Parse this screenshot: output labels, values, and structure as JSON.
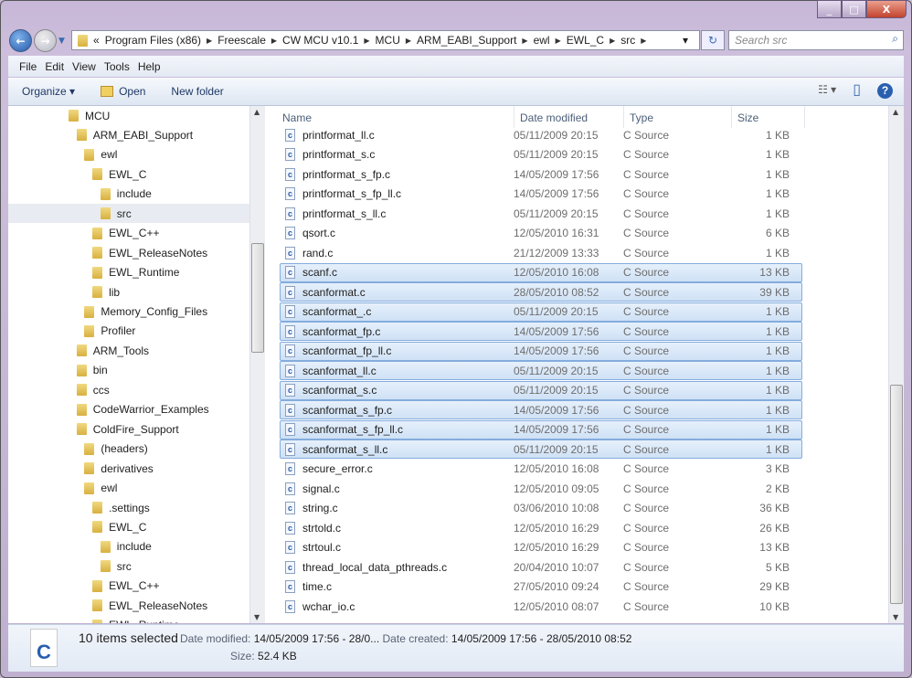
{
  "window": {
    "minimize": "_",
    "maximize": "□",
    "close": "X"
  },
  "address": {
    "prefix": "«",
    "crumbs": [
      "Program Files (x86)",
      "Freescale",
      "CW MCU v10.1",
      "MCU",
      "ARM_EABI_Support",
      "ewl",
      "EWL_C",
      "src"
    ],
    "dropdown": "▾",
    "refresh": "↻"
  },
  "search": {
    "placeholder": "Search src",
    "icon": "magnifier-icon"
  },
  "menu": [
    "File",
    "Edit",
    "View",
    "Tools",
    "Help"
  ],
  "toolbar": {
    "organize": "Organize ▾",
    "open": "Open",
    "new_folder": "New folder",
    "views": "☷ ▾",
    "preview": "▯",
    "help": "?"
  },
  "tree": [
    {
      "label": "MCU",
      "level": 0
    },
    {
      "label": "ARM_EABI_Support",
      "level": 1
    },
    {
      "label": "ewl",
      "level": 2
    },
    {
      "label": "EWL_C",
      "level": 3
    },
    {
      "label": "include",
      "level": 4
    },
    {
      "label": "src",
      "level": 4,
      "selected": true
    },
    {
      "label": "EWL_C++",
      "level": 3
    },
    {
      "label": "EWL_ReleaseNotes",
      "level": 3
    },
    {
      "label": "EWL_Runtime",
      "level": 3
    },
    {
      "label": "lib",
      "level": 3
    },
    {
      "label": "Memory_Config_Files",
      "level": 2
    },
    {
      "label": "Profiler",
      "level": 2
    },
    {
      "label": "ARM_Tools",
      "level": 1
    },
    {
      "label": "bin",
      "level": 1
    },
    {
      "label": "ccs",
      "level": 1
    },
    {
      "label": "CodeWarrior_Examples",
      "level": 1
    },
    {
      "label": "ColdFire_Support",
      "level": 1
    },
    {
      "label": "(headers)",
      "level": 2
    },
    {
      "label": "derivatives",
      "level": 2
    },
    {
      "label": "ewl",
      "level": 2
    },
    {
      "label": ".settings",
      "level": 3
    },
    {
      "label": "EWL_C",
      "level": 3
    },
    {
      "label": "include",
      "level": 4
    },
    {
      "label": "src",
      "level": 4
    },
    {
      "label": "EWL_C++",
      "level": 3
    },
    {
      "label": "EWL_ReleaseNotes",
      "level": 3
    },
    {
      "label": "EWL_Runtime",
      "level": 3
    }
  ],
  "columns": [
    "Name",
    "Date modified",
    "Type",
    "Size"
  ],
  "files": [
    [
      "printformat_ll.c",
      "05/11/2009 20:15",
      "C Source",
      "1 KB",
      0
    ],
    [
      "printformat_s.c",
      "05/11/2009 20:15",
      "C Source",
      "1 KB",
      0
    ],
    [
      "printformat_s_fp.c",
      "14/05/2009 17:56",
      "C Source",
      "1 KB",
      0
    ],
    [
      "printformat_s_fp_ll.c",
      "14/05/2009 17:56",
      "C Source",
      "1 KB",
      0
    ],
    [
      "printformat_s_ll.c",
      "05/11/2009 20:15",
      "C Source",
      "1 KB",
      0
    ],
    [
      "qsort.c",
      "12/05/2010 16:31",
      "C Source",
      "6 KB",
      0
    ],
    [
      "rand.c",
      "21/12/2009 13:33",
      "C Source",
      "1 KB",
      0
    ],
    [
      "scanf.c",
      "12/05/2010 16:08",
      "C Source",
      "13 KB",
      1
    ],
    [
      "scanformat.c",
      "28/05/2010 08:52",
      "C Source",
      "39 KB",
      1
    ],
    [
      "scanformat_.c",
      "05/11/2009 20:15",
      "C Source",
      "1 KB",
      1
    ],
    [
      "scanformat_fp.c",
      "14/05/2009 17:56",
      "C Source",
      "1 KB",
      1
    ],
    [
      "scanformat_fp_ll.c",
      "14/05/2009 17:56",
      "C Source",
      "1 KB",
      1
    ],
    [
      "scanformat_ll.c",
      "05/11/2009 20:15",
      "C Source",
      "1 KB",
      1
    ],
    [
      "scanformat_s.c",
      "05/11/2009 20:15",
      "C Source",
      "1 KB",
      1
    ],
    [
      "scanformat_s_fp.c",
      "14/05/2009 17:56",
      "C Source",
      "1 KB",
      1
    ],
    [
      "scanformat_s_fp_ll.c",
      "14/05/2009 17:56",
      "C Source",
      "1 KB",
      1
    ],
    [
      "scanformat_s_ll.c",
      "05/11/2009 20:15",
      "C Source",
      "1 KB",
      1
    ],
    [
      "secure_error.c",
      "12/05/2010 16:08",
      "C Source",
      "3 KB",
      0
    ],
    [
      "signal.c",
      "12/05/2010 09:05",
      "C Source",
      "2 KB",
      0
    ],
    [
      "string.c",
      "03/06/2010 10:08",
      "C Source",
      "36 KB",
      0
    ],
    [
      "strtold.c",
      "12/05/2010 16:29",
      "C Source",
      "26 KB",
      0
    ],
    [
      "strtoul.c",
      "12/05/2010 16:29",
      "C Source",
      "13 KB",
      0
    ],
    [
      "thread_local_data_pthreads.c",
      "20/04/2010 10:07",
      "C Source",
      "5 KB",
      0
    ],
    [
      "time.c",
      "27/05/2010 09:24",
      "C Source",
      "29 KB",
      0
    ],
    [
      "wchar_io.c",
      "12/05/2010 08:07",
      "C Source",
      "10 KB",
      0
    ]
  ],
  "details": {
    "count": "10 items selected",
    "date_modified_label": "Date modified:",
    "date_modified": "14/05/2009 17:56 - 28/0...",
    "date_created_label": "Date created:",
    "date_created": "14/05/2009 17:56 - 28/05/2010 08:52",
    "size_label": "Size:",
    "size": "52.4 KB",
    "icon_letter": "C"
  },
  "colors": {
    "selection": "#cfe1f6",
    "selection_border": "#84acdd",
    "link": "#1e3966"
  }
}
